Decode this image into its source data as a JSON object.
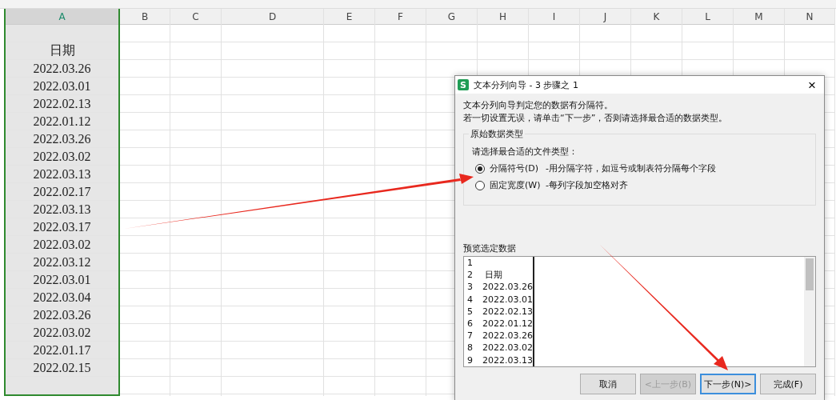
{
  "sheet": {
    "columns": [
      {
        "label": "A",
        "selected": true
      },
      {
        "label": "B",
        "selected": false
      },
      {
        "label": "C",
        "selected": false
      },
      {
        "label": "D",
        "selected": false
      },
      {
        "label": "E",
        "selected": false
      },
      {
        "label": "F",
        "selected": false
      },
      {
        "label": "G",
        "selected": false
      },
      {
        "label": "H",
        "selected": false
      },
      {
        "label": "I",
        "selected": false
      },
      {
        "label": "J",
        "selected": false
      },
      {
        "label": "K",
        "selected": false
      },
      {
        "label": "L",
        "selected": false
      },
      {
        "label": "M",
        "selected": false
      },
      {
        "label": "N",
        "selected": false
      }
    ],
    "column_a": [
      "日期",
      "2022.03.26",
      "2022.03.01",
      "2022.02.13",
      "2022.01.12",
      "2022.03.26",
      "2022.03.02",
      "2022.03.13",
      "2022.02.17",
      "2022.03.13",
      "2022.03.17",
      "2022.03.02",
      "2022.03.12",
      "2022.03.01",
      "2022.03.04",
      "2022.03.26",
      "2022.03.02",
      "2022.01.17",
      "2022.02.15"
    ]
  },
  "dialog": {
    "app_badge": "S",
    "title": "文本分列向导 - 3 步骤之 1",
    "close": "×",
    "intro": [
      "文本分列向导判定您的数据有分隔符。",
      "若一切设置无误，请单击“下一步”，否则请选择最合适的数据类型。"
    ],
    "group_title": "原始数据类型",
    "prompt": "请选择最合适的文件类型：",
    "options": [
      {
        "label": "分隔符号(D)",
        "description": "-用分隔字符，如逗号或制表符分隔每个字段",
        "selected": true
      },
      {
        "label": "固定宽度(W)",
        "description": "-每列字段加空格对齐",
        "selected": false
      }
    ],
    "preview_title": "预览选定数据",
    "preview_rows": [
      {
        "number": "1"
      },
      {
        "number": "2",
        "value": "日期"
      },
      {
        "number": "3",
        "value": "2022.03.26"
      },
      {
        "number": "4",
        "value": "2022.03.01"
      },
      {
        "number": "5",
        "value": "2022.02.13"
      },
      {
        "number": "6",
        "value": "2022.01.12"
      },
      {
        "number": "7",
        "value": "2022.03.26"
      },
      {
        "number": "8",
        "value": "2022.03.02"
      },
      {
        "number": "9",
        "value": "2022.03.13"
      }
    ],
    "buttons": [
      {
        "label": "取消",
        "disabled": false,
        "focused": false
      },
      {
        "label": "<上一步(B)",
        "disabled": true,
        "focused": false
      },
      {
        "label": "下一步(N)>",
        "disabled": false,
        "focused": true
      },
      {
        "label": "完成(F)",
        "disabled": false,
        "focused": false
      }
    ]
  }
}
